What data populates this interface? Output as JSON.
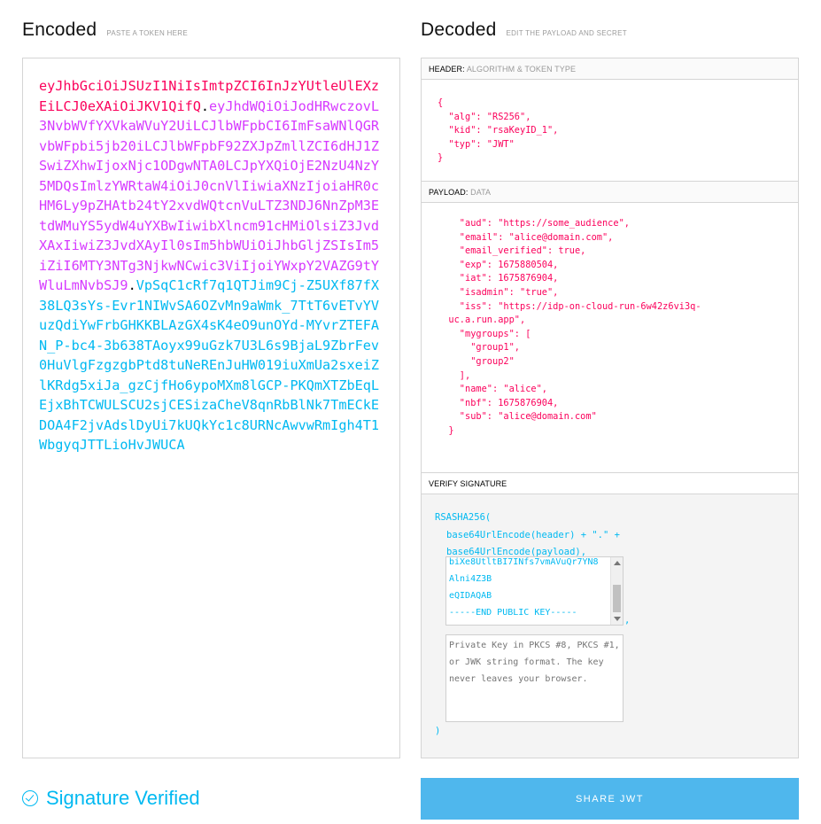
{
  "encoded": {
    "title": "Encoded",
    "subtitle": "PASTE A TOKEN HERE",
    "token_header": "eyJhbGciOiJSUzI1NiIsImtpZCI6InJzYUtleUlEXzEiLCJ0eXAiOiJKV1QifQ",
    "token_payload": "eyJhdWQiOiJodHRwczovL3NvbWVfYXVkaWVuY2UiLCJlbWFpbCI6ImFsaWNlQGRvbWFpbi5jb20iLCJlbWFpbF92ZXJpZmllZCI6dHJ1ZSwiZXhwIjoxNjc1ODgwNTA0LCJpYXQiOjE2NzU4NzY5MDQsImlzYWRtaW4iOiJ0cnVlIiwiaXNzIjoiaHR0cHM6Ly9pZHAtb24tY2xvdWQtcnVuLTZ3NDJ6NnZpM3EtdWMuYS5ydW4uYXBwIiwibXlncm91cHMiOlsiZ3JvdXAxIiwiZ3JvdXAyIl0sIm5hbWUiOiJhbGljZSIsIm5iZiI6MTY3NTg3NjkwNCwic3ViIjoiYWxpY2VAZG9tYWluLmNvbSJ9",
    "token_signature": "VpSqC1cRf7q1QTJim9Cj-Z5UXf87fX38LQ3sYs-Evr1NIWvSA6OZvMn9aWmk_7TtT6vETvYVuzQdiYwFrbGHKKBLAzGX4sK4eO9unOYd-MYvrZTEFAN_P-bc4-3b638TAoyx99uGzk7U3L6s9BjaL9ZbrFev0HuVlgFzgzgbPtd8tuNeREnJuHW019iuXmUa2sxeiZlKRdg5xiJa_gzCjfHo6ypoMXm8lGCP-PKQmXTZbEqLEjxBhTCWULSCU2sjCESizaCheV8qnRbBlNk7TmECkEDOA4F2jvAdslDyUi7kUQkYc1c8URNcAwvwRmIgh4T1WbgyqJTTLioHvJWUCA",
    "dot": "."
  },
  "decoded": {
    "title": "Decoded",
    "subtitle": "EDIT THE PAYLOAD AND SECRET",
    "header_section": {
      "label": "HEADER:",
      "sub": "ALGORITHM & TOKEN TYPE",
      "json": "{\n  \"alg\": \"RS256\",\n  \"kid\": \"rsaKeyID_1\",\n  \"typ\": \"JWT\"\n}"
    },
    "payload_section": {
      "label": "PAYLOAD:",
      "sub": "DATA",
      "json": "    \"aud\": \"https://some_audience\",\n    \"email\": \"alice@domain.com\",\n    \"email_verified\": true,\n    \"exp\": 1675880504,\n    \"iat\": 1675876904,\n    \"isadmin\": \"true\",\n    \"iss\": \"https://idp-on-cloud-run-6w42z6vi3q-\n  uc.a.run.app\",\n    \"mygroups\": [\n      \"group1\",\n      \"group2\"\n    ],\n    \"name\": \"alice\",\n    \"nbf\": 1675876904,\n    \"sub\": \"alice@domain.com\"\n  }"
    },
    "verify_section": {
      "label": "VERIFY SIGNATURE",
      "line1": "RSASHA256(",
      "line2": "base64UrlEncode(header) + \".\" +",
      "line3": "base64UrlEncode(payload),",
      "public_key_visible": "biXe8UtltBI7INfs7vmAVuQr7YN8\nAlni4Z3B\neQIDAQAB\n-----END PUBLIC KEY-----",
      "comma": ",",
      "private_key_placeholder": "Private Key in PKCS #8, PKCS #1, or JWK string format. The key never leaves your browser.",
      "close": ")"
    }
  },
  "status": {
    "label": "Signature Verified"
  },
  "share_button": {
    "label": "SHARE JWT"
  },
  "colors": {
    "header": "#fb015b",
    "payload": "#d63aff",
    "signature": "#00b9f1",
    "button": "#4fb7ed"
  }
}
